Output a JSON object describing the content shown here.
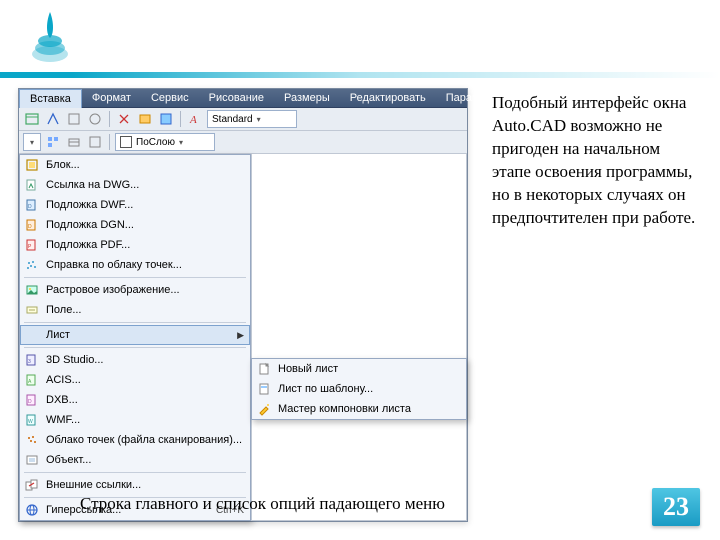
{
  "menubar": {
    "items": [
      "Вставка",
      "Формат",
      "Сервис",
      "Рисование",
      "Размеры",
      "Редактировать",
      "Параметризация"
    ],
    "open_index": 0
  },
  "toolbar": {
    "style_label": "Standard",
    "layer_label": "ПоСлою"
  },
  "dropdown": {
    "items": [
      {
        "icon": "block",
        "label": "Блок...",
        "sep": false
      },
      {
        "icon": "dwg",
        "label": "Ссылка на DWG...",
        "sep": false
      },
      {
        "icon": "dwf",
        "label": "Подложка DWF...",
        "sep": false
      },
      {
        "icon": "dgn",
        "label": "Подложка DGN...",
        "sep": false
      },
      {
        "icon": "pdf",
        "label": "Подложка PDF...",
        "sep": false
      },
      {
        "icon": "pcloud",
        "label": "Справка по облаку точек...",
        "sep": false,
        "sep_after": true
      },
      {
        "icon": "raster",
        "label": "Растровое изображение...",
        "sep": false
      },
      {
        "icon": "field",
        "label": "Поле...",
        "sep": false,
        "sep_after": true
      },
      {
        "icon": "",
        "label": "Лист",
        "sub": true,
        "hl": true,
        "sep_after": true
      },
      {
        "icon": "3ds",
        "label": "3D Studio...",
        "sep": false
      },
      {
        "icon": "acis",
        "label": "ACIS...",
        "sep": false
      },
      {
        "icon": "dxb",
        "label": "DXB...",
        "sep": false
      },
      {
        "icon": "wmf",
        "label": "WMF...",
        "sep": false
      },
      {
        "icon": "pcloudf",
        "label": "Облако точек (файла сканирования)...",
        "sep": false
      },
      {
        "icon": "ole",
        "label": "Объект...",
        "sep": false,
        "sep_after": true
      },
      {
        "icon": "xref",
        "label": "Внешние ссылки...",
        "sep": false,
        "sep_after": true
      },
      {
        "icon": "hyper",
        "label": "Гиперссылка...",
        "shortcut": "Ctrl+K",
        "sep": false
      }
    ]
  },
  "submenu": {
    "items": [
      {
        "icon": "newsheet",
        "label": "Новый лист"
      },
      {
        "icon": "tmpl",
        "label": "Лист по шаблону..."
      },
      {
        "icon": "wizard",
        "label": "Мастер компоновки листа"
      }
    ]
  },
  "side_text": "Подобный интерфейс окна Auto.CAD возможно не пригоден на начальном этапе освоения программы, но в некоторых случаях он предпочтителен при работе.",
  "caption": "Строка главного и список опций падающего меню",
  "page_number": "23"
}
